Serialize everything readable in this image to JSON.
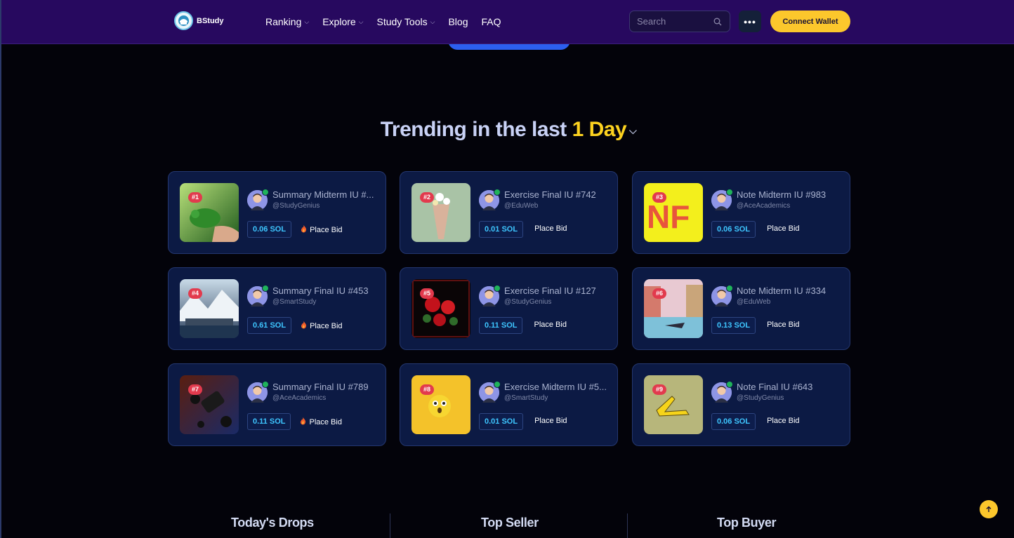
{
  "header": {
    "brand": "BStudy",
    "nav": [
      {
        "label": "Ranking",
        "dropdown": true
      },
      {
        "label": "Explore",
        "dropdown": true
      },
      {
        "label": "Study Tools",
        "dropdown": true
      },
      {
        "label": "Blog",
        "dropdown": false
      },
      {
        "label": "FAQ",
        "dropdown": false
      }
    ],
    "search_placeholder": "Search",
    "more_label": "•••",
    "connect_label": "Connect Wallet"
  },
  "trending": {
    "title_prefix": "Trending in the last ",
    "title_period": "1 Day",
    "items": [
      {
        "rank": "#1",
        "title": "Summary Midterm IU #...",
        "handle": "@StudyGenius",
        "price": "0.06 SOL",
        "bid": "Place Bid",
        "hot": true,
        "thumb": "chameleon"
      },
      {
        "rank": "#2",
        "title": "Exercise Final IU #742",
        "handle": "@EduWeb",
        "price": "0.01 SOL",
        "bid": "Place Bid",
        "hot": false,
        "thumb": "bouquet"
      },
      {
        "rank": "#3",
        "title": "Note Midterm IU #983",
        "handle": "@AceAcademics",
        "price": "0.06 SOL",
        "bid": "Place Bid",
        "hot": false,
        "thumb": "nf-letters"
      },
      {
        "rank": "#4",
        "title": "Summary Final IU #453",
        "handle": "@SmartStudy",
        "price": "0.61 SOL",
        "bid": "Place Bid",
        "hot": true,
        "thumb": "snow-village"
      },
      {
        "rank": "#5",
        "title": "Exercise Final IU #127",
        "handle": "@StudyGenius",
        "price": "0.11 SOL",
        "bid": "Place Bid",
        "hot": false,
        "thumb": "red-flowers"
      },
      {
        "rank": "#6",
        "title": "Note Midterm IU #334",
        "handle": "@EduWeb",
        "price": "0.13 SOL",
        "bid": "Place Bid",
        "hot": false,
        "thumb": "venice-painting"
      },
      {
        "rank": "#7",
        "title": "Summary Final IU #789",
        "handle": "@AceAcademics",
        "price": "0.11 SOL",
        "bid": "Place Bid",
        "hot": true,
        "thumb": "black-spheres"
      },
      {
        "rank": "#8",
        "title": "Exercise Midterm IU #5...",
        "handle": "@SmartStudy",
        "price": "0.01 SOL",
        "bid": "Place Bid",
        "hot": false,
        "thumb": "surprised-emoji"
      },
      {
        "rank": "#9",
        "title": "Note Final IU #643",
        "handle": "@StudyGenius",
        "price": "0.06 SOL",
        "bid": "Place Bid",
        "hot": false,
        "thumb": "pixel-banana"
      }
    ]
  },
  "bottom_tabs": [
    "Today's Drops",
    "Top Seller",
    "Top Buyer"
  ],
  "colors": {
    "accent": "#fcc72c",
    "header_bg": "#27095f",
    "card_bg": "#0c1a44",
    "price": "#3ec6ff",
    "rank_badge": "#e23a4d"
  }
}
